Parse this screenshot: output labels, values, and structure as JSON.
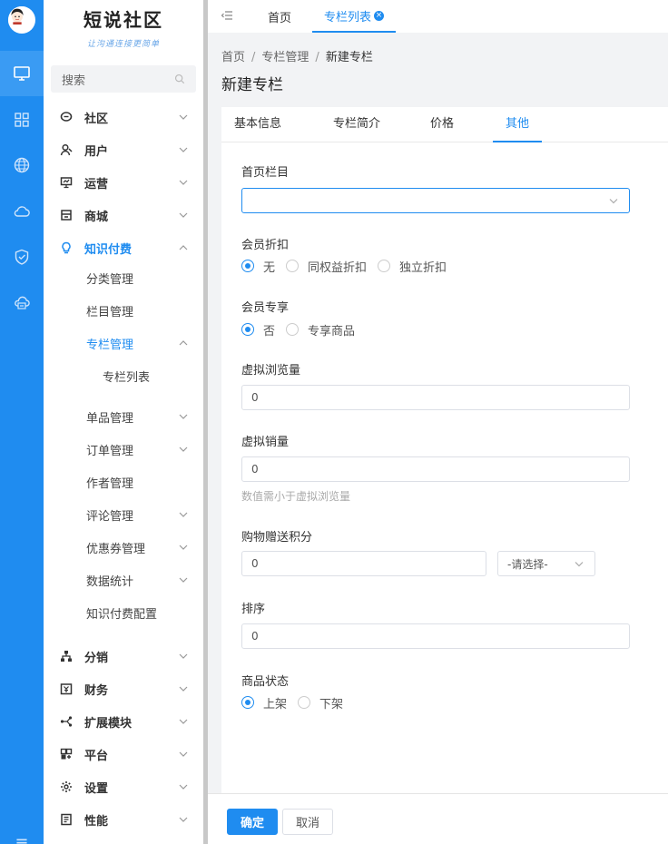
{
  "logo": {
    "brand": "短说社区",
    "slogan": "让沟通连接更简单"
  },
  "search": {
    "placeholder": "搜索"
  },
  "menu": {
    "community": "社区",
    "users": "用户",
    "operations": "运营",
    "mall": "商城",
    "knowledge": "知识付费",
    "category_mgmt": "分类管理",
    "column_mgmt": "栏目管理",
    "special_mgmt": "专栏管理",
    "special_list": "专栏列表",
    "item_mgmt": "单品管理",
    "order_mgmt": "订单管理",
    "author_mgmt": "作者管理",
    "comment_mgmt": "评论管理",
    "coupon_mgmt": "优惠券管理",
    "data_stats": "数据统计",
    "knowledge_config": "知识付费配置",
    "distribution": "分销",
    "finance": "财务",
    "extensions": "扩展模块",
    "platform": "平台",
    "settings": "设置",
    "performance": "性能"
  },
  "topbar": {
    "home_tab": "首页",
    "active_tab": "专栏列表"
  },
  "breadcrumb": {
    "home": "首页",
    "parent": "专栏管理",
    "current": "新建专栏"
  },
  "page_title": "新建专栏",
  "tabs": {
    "basic": "基本信息",
    "intro": "专栏简介",
    "price": "价格",
    "other": "其他"
  },
  "form": {
    "home_column_label": "首页栏目",
    "home_column_value": "",
    "member_discount_label": "会员折扣",
    "discount_none": "无",
    "discount_same": "同权益折扣",
    "discount_independent": "独立折扣",
    "member_exclusive_label": "会员专享",
    "exclusive_no": "否",
    "exclusive_yes": "专享商品",
    "virtual_views_label": "虚拟浏览量",
    "virtual_views_value": "0",
    "virtual_sales_label": "虚拟销量",
    "virtual_sales_value": "0",
    "virtual_sales_hint": "数值需小于虚拟浏览量",
    "points_label": "购物赠送积分",
    "points_value": "0",
    "points_select": "-请选择-",
    "sort_label": "排序",
    "sort_value": "0",
    "status_label": "商品状态",
    "status_on": "上架",
    "status_off": "下架"
  },
  "footer": {
    "confirm": "确定",
    "cancel": "取消"
  },
  "colors": {
    "accent": "#1f8cf0",
    "rail": "#1f8cf0"
  }
}
